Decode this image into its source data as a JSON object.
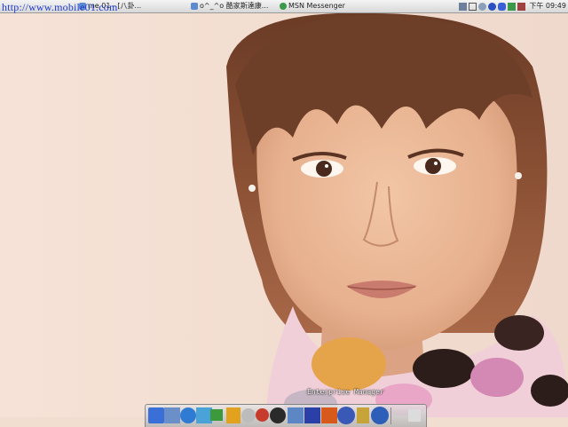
{
  "topbar": {
    "url_overlay": "http://www.mobile01.com",
    "tasks": [
      {
        "label": "me 01 - [八卦..."
      },
      {
        "label": "o^_^o 酷家斯達康..."
      },
      {
        "label": "MSN Messenger"
      }
    ],
    "tray": {
      "clock": "下午 09:49",
      "icons": [
        "network-icon",
        "arrows-icon",
        "sync-icon",
        "messenger-icon",
        "bluetooth-icon",
        "shield-icon",
        "chart-icon"
      ]
    }
  },
  "dock": {
    "hover_label": "Enterprise Manager",
    "items": [
      {
        "name": "finder-icon",
        "color": "#3b6fd8"
      },
      {
        "name": "photo-icon",
        "color": "#6b8fc9"
      },
      {
        "name": "ie-icon",
        "color": "#2f7bd4"
      },
      {
        "name": "network-tool-icon",
        "color": "#4aa3d8"
      },
      {
        "name": "terminal-icon",
        "color": "#3c9a3c"
      },
      {
        "name": "lightning-icon",
        "color": "#e2a21e"
      },
      {
        "name": "cd-icon",
        "color": "#bcbcbc"
      },
      {
        "name": "spiral-icon",
        "color": "#c63b2b"
      },
      {
        "name": "ultraedit-icon",
        "color": "#2a2a2a"
      },
      {
        "name": "monitor-icon",
        "color": "#5c86c4"
      },
      {
        "name": "word-icon",
        "color": "#2b3fa8"
      },
      {
        "name": "powerpoint-icon",
        "color": "#d85a1a"
      },
      {
        "name": "realplayer-icon",
        "color": "#3a58b6"
      },
      {
        "name": "thermometer-icon",
        "color": "#c7a43a"
      },
      {
        "name": "java-icon",
        "color": "#2d5fb8"
      },
      {
        "name": "trash-icon",
        "color": "#dcdcdc"
      }
    ]
  }
}
